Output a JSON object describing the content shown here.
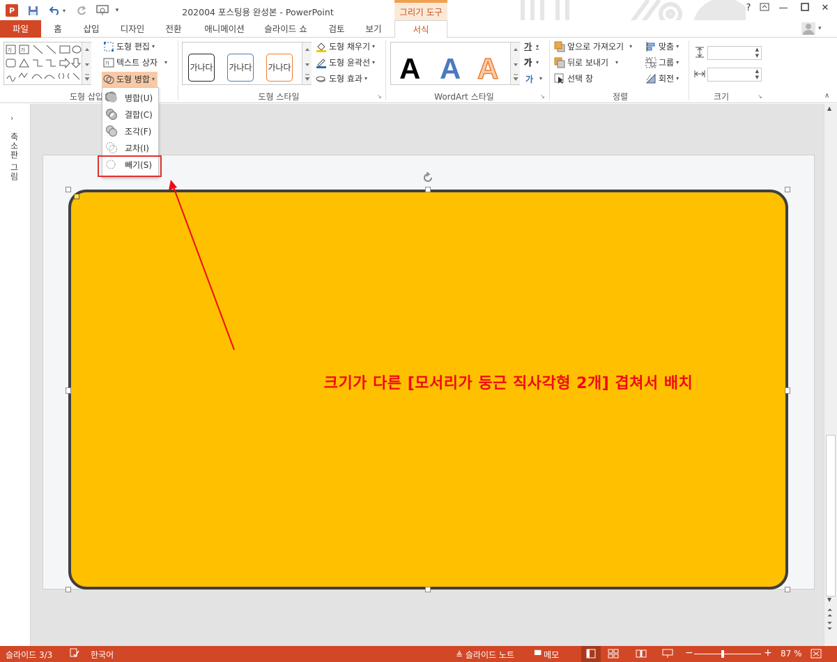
{
  "window": {
    "title": "202004 포스팅용 완성본 - PowerPoint",
    "context_tab_header": "그리기 도구"
  },
  "tabs": [
    {
      "label": "파일"
    },
    {
      "label": "홈"
    },
    {
      "label": "삽입"
    },
    {
      "label": "디자인"
    },
    {
      "label": "전환"
    },
    {
      "label": "애니메이션"
    },
    {
      "label": "슬라이드 쇼"
    },
    {
      "label": "검토"
    },
    {
      "label": "보기"
    },
    {
      "label": "서식"
    }
  ],
  "active_tab": "서식",
  "ribbon": {
    "insert_shapes": {
      "label": "도형 삽입",
      "edit_shape": "도형 편집",
      "text_box": "텍스트 상자",
      "merge_shapes": "도형 병합"
    },
    "shape_styles": {
      "label": "도형 스타일",
      "swatch_text": "가나다",
      "fill": "도형 채우기",
      "outline": "도형 윤곽선",
      "effects": "도형 효과"
    },
    "wordart": {
      "label": "WordArt 스타일",
      "letter": "A",
      "text_fill_icon": "가",
      "text_outline_icon": "가"
    },
    "arrange": {
      "label": "정렬",
      "bring_forward": "앞으로 가져오기",
      "send_backward": "뒤로 보내기",
      "selection_pane": "선택 창",
      "align": "맞춤",
      "group": "그룹",
      "rotate": "회전"
    },
    "size": {
      "label": "크기",
      "height": "",
      "width": ""
    }
  },
  "merge_menu": {
    "items": [
      {
        "label": "병합(U)"
      },
      {
        "label": "결합(C)"
      },
      {
        "label": "조각(F)"
      },
      {
        "label": "교차(I)"
      },
      {
        "label": "빼기(S)"
      }
    ],
    "highlighted": "빼기(S)"
  },
  "thumbnail_pane": {
    "label": "축소판 그림"
  },
  "annotation": {
    "text": "크기가 다른 [모서리가 둥근 직사각형 2개] 겹쳐서 배치",
    "color": "#f00a14"
  },
  "slide": {
    "shape_fill": "#ffc000",
    "shape_outline": "#3f3f3f"
  },
  "statusbar": {
    "slide_indicator": "슬라이드 3/3",
    "language": "한국어",
    "notes": "슬라이드 노트",
    "comments": "메모",
    "zoom": "87 %",
    "zoom_percent": 87
  },
  "colors": {
    "accent": "#d24726",
    "context_tab": "#c4561f"
  }
}
